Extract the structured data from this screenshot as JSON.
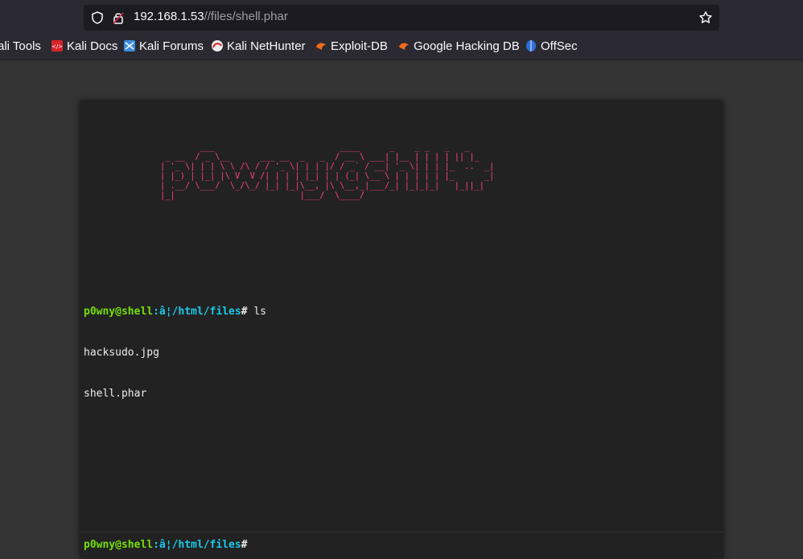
{
  "browser": {
    "url_host": "192.168.1.53",
    "url_path": "//files/shell.phar",
    "icons": {
      "shield": "shield-icon",
      "lock": "insecure-lock-icon",
      "star": "bookmark-star-icon"
    }
  },
  "bookmarks": [
    {
      "label": "ali Tools",
      "icon": "none"
    },
    {
      "label": "Kali Docs",
      "icon": "kali-docs-icon"
    },
    {
      "label": "Kali Forums",
      "icon": "kali-forums-icon"
    },
    {
      "label": "Kali NetHunter",
      "icon": "kali-nethunter-icon"
    },
    {
      "label": "Exploit-DB",
      "icon": "exploit-db-icon"
    },
    {
      "label": "Google Hacking DB",
      "icon": "google-hacking-db-icon"
    },
    {
      "label": "OffSec",
      "icon": "offsec-icon"
    }
  ],
  "terminal": {
    "banner": "        ___                         ____      _    _ _   _   _\n _ __  / _ \\__      ___ __  _   _  / __ \\ ___| |__ | | | | || |_\n| '_ \\| | | \\ \\ /\\ / / '_ \\| | | |/ / _` / __| '_ \\| | | |_  ..  _|\n| |_) | |_| |\\ V  V /| | | | |_| | | (_| \\__ \\ | | | | | |_      _|\n| .__/ \\___/  \\_/\\_/ |_| |_|\\__, |\\ \\__,_|___/_| |_|_|_|   |_||_|\n|_|                         |___/  \\____/",
    "prompt_user": "p0wny@shell",
    "prompt_path": ":â¦/html/files",
    "prompt_hash": "#",
    "history": [
      {
        "command": " ls",
        "output": [
          "hacksudo.jpg",
          "shell.phar"
        ]
      }
    ],
    "input_value": ""
  },
  "colors": {
    "banner": "#ff4180",
    "prompt_user": "#75df0b",
    "prompt_path": "#1bc9e7",
    "terminal_bg": "#222222"
  }
}
